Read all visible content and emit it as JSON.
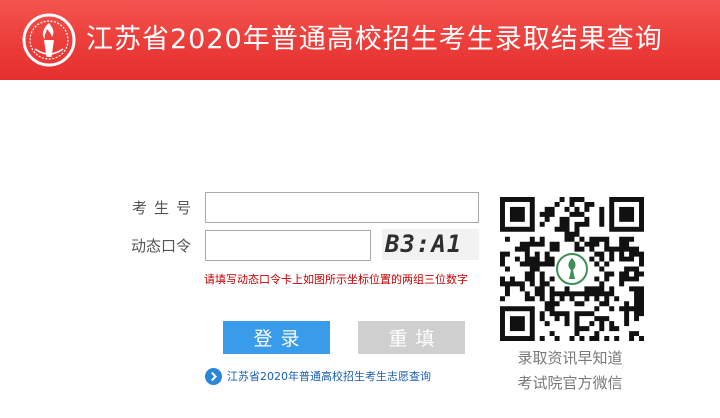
{
  "header": {
    "title": "江苏省2020年普通高校招生考生录取结果查询",
    "background_color": "#ec3d3a",
    "logo_icon": "torch-seal-logo-icon"
  },
  "form": {
    "exam_number_label": "考生号",
    "exam_number_value": "",
    "dynamic_password_label": "动态口令",
    "dynamic_password_value": "",
    "captcha_text": "B3:A1",
    "hint": "请填写动态口令卡上如图所示坐标位置的两组三位数字",
    "hint_color": "#c40000"
  },
  "buttons": {
    "login_label": "登录",
    "login_color": "#399cea",
    "reset_label": "重填",
    "reset_color": "#cfcfcf"
  },
  "link": {
    "label": "江苏省2020年普通高校招生考生志愿查询",
    "icon": "chevron-right-circle-icon"
  },
  "qr": {
    "icon": "qr-code-icon",
    "caption_line1": "录取资讯早知道",
    "caption_line2": "考试院官方微信"
  }
}
